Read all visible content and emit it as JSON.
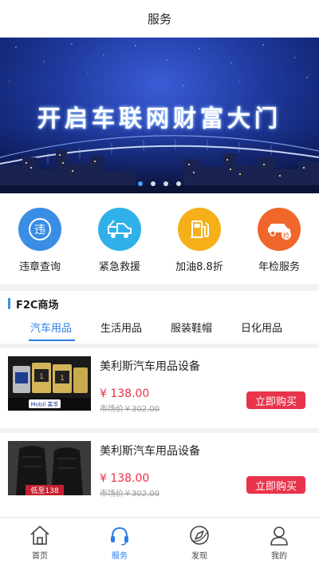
{
  "header": {
    "title": "服务"
  },
  "banner": {
    "headline": "开启车联网财富大门",
    "active_slide": 1,
    "slide_count": 4
  },
  "services": [
    {
      "label": "违章查询",
      "icon": "violation-icon",
      "glyph": "违",
      "color": "#3a8de4"
    },
    {
      "label": "紧急救援",
      "icon": "tow-truck-icon",
      "color": "#2fb0e8"
    },
    {
      "label": "加油8.8折",
      "icon": "fuel-pump-icon",
      "color": "#f5b019"
    },
    {
      "label": "年检服务",
      "icon": "car-inspection-icon",
      "glyph": "检",
      "color": "#f0662b"
    }
  ],
  "mall": {
    "title": "F2C商场",
    "tabs": [
      "汽车用品",
      "生活用品",
      "服装鞋帽",
      "日化用品"
    ],
    "active_tab": 0,
    "accent": "#2b7de9"
  },
  "products": [
    {
      "name": "美利斯汽车用品设备",
      "price": "¥ 138.00",
      "market_price": "市场价￥302.00",
      "buy_label": "立即购买",
      "image": "motor-oil-bottles",
      "image_text": "Mobil 美孚"
    },
    {
      "name": "美利斯汽车用品设备",
      "price": "¥ 138.00",
      "market_price": "市场价￥302.00",
      "buy_label": "立即购买",
      "image": "car-seat-covers",
      "image_text": "低至138"
    }
  ],
  "tabbar": [
    {
      "label": "首页",
      "icon": "home-icon"
    },
    {
      "label": "服务",
      "icon": "headset-icon",
      "active": true
    },
    {
      "label": "发现",
      "icon": "compass-icon"
    },
    {
      "label": "我的",
      "icon": "user-icon"
    }
  ],
  "colors": {
    "price": "#e8334a",
    "accent": "#2b7de9"
  }
}
